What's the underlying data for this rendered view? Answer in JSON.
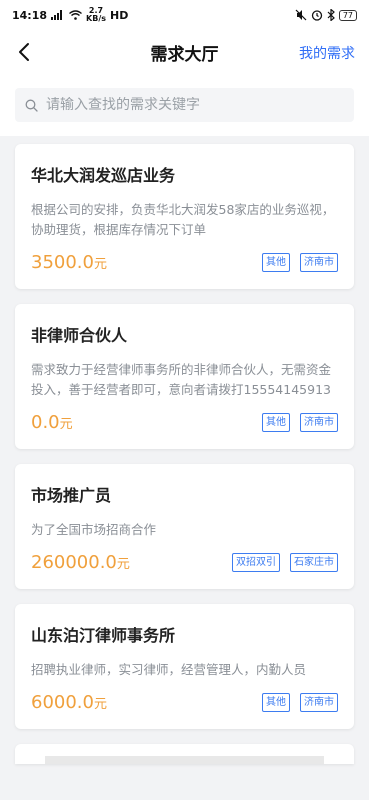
{
  "status_bar": {
    "time": "14:18",
    "signal_text": "4G",
    "network": "HD",
    "net_speed_top": "2.7",
    "net_speed_bottom": "KB/s",
    "battery": "77"
  },
  "nav": {
    "back_icon": "back-arrow-icon",
    "title": "需求大厅",
    "right_link": "我的需求"
  },
  "search": {
    "placeholder": "请输入查找的需求关键字",
    "icon": "search-icon"
  },
  "cards": [
    {
      "title": "华北大润发巡店业务",
      "desc": "根据公司的安排，负责华北大润发58家店的业务巡视，协助理货，根据库存情况下订单",
      "price": "3500.0",
      "unit": "元",
      "tags": [
        "其他",
        "济南市"
      ]
    },
    {
      "title": "非律师合伙人",
      "desc": "需求致力于经营律师事务所的非律师合伙人，无需资金投入，善于经营者即可，意向者请拨打15554145913",
      "price": "0.0",
      "unit": "元",
      "tags": [
        "其他",
        "济南市"
      ]
    },
    {
      "title": "市场推广员",
      "desc": "为了全国市场招商合作",
      "price": "260000.0",
      "unit": "元",
      "tags": [
        "双招双引",
        "石家庄市"
      ]
    },
    {
      "title": "山东泊汀律师事务所",
      "desc": "招聘执业律师，实习律师，经营管理人，内勤人员",
      "price": "6000.0",
      "unit": "元",
      "tags": [
        "其他",
        "济南市"
      ]
    }
  ],
  "colors": {
    "accent": "#2f6df6",
    "price": "#f0a03c",
    "tag": "#3d7cf0"
  }
}
